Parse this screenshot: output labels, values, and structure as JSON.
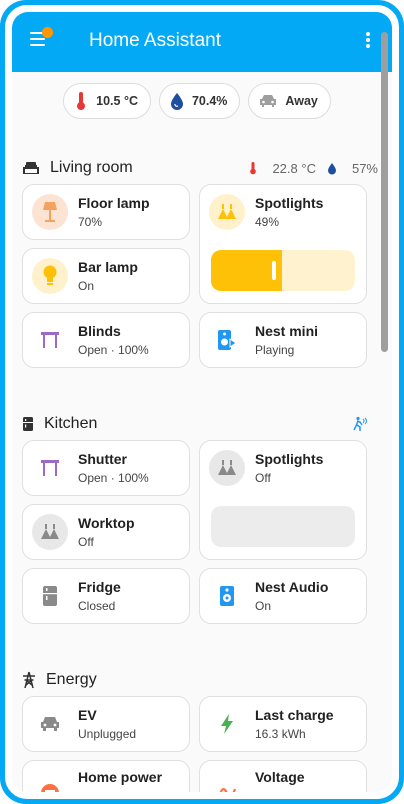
{
  "header": {
    "title": "Home Assistant"
  },
  "badges": [
    {
      "icon": "thermometer-icon",
      "value": "10.5 °C"
    },
    {
      "icon": "water-drop-icon",
      "value": "70.4%"
    },
    {
      "icon": "car-icon",
      "value": "Away"
    }
  ],
  "living_room": {
    "title": "Living room",
    "temperature": "22.8 °C",
    "humidity": "57%",
    "cards": {
      "floor_lamp": {
        "name": "Floor lamp",
        "state": "70%"
      },
      "spotlights": {
        "name": "Spotlights",
        "state": "49%",
        "brightness_percent": 49
      },
      "bar_lamp": {
        "name": "Bar lamp",
        "state": "On"
      },
      "blinds": {
        "name": "Blinds",
        "state": "Open · 100%"
      },
      "nest_mini": {
        "name": "Nest mini",
        "state": "Playing"
      }
    }
  },
  "kitchen": {
    "title": "Kitchen",
    "cards": {
      "shutter": {
        "name": "Shutter",
        "state": "Open · 100%"
      },
      "spotlights": {
        "name": "Spotlights",
        "state": "Off"
      },
      "worktop": {
        "name": "Worktop",
        "state": "Off"
      },
      "fridge": {
        "name": "Fridge",
        "state": "Closed"
      },
      "nest_audio": {
        "name": "Nest Audio",
        "state": "On"
      }
    }
  },
  "energy": {
    "title": "Energy",
    "cards": {
      "ev": {
        "name": "EV",
        "state": "Unplugged"
      },
      "last_charge": {
        "name": "Last charge",
        "state": "16.3 kWh"
      },
      "home_power": {
        "name": "Home power"
      },
      "voltage": {
        "name": "Voltage"
      }
    }
  },
  "colors": {
    "primary": "#03a9f4",
    "light_on": "#ffc107",
    "cover": "#9c6ac4",
    "media": "#2196f3",
    "energy": "#4caf50",
    "accent": "#ff9800"
  }
}
